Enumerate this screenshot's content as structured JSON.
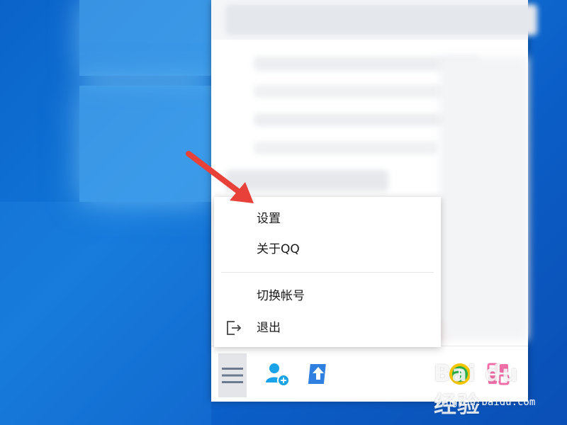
{
  "menu": {
    "settings": "设置",
    "about": "关于QQ",
    "switch_account": "切换帐号",
    "exit": "退出"
  },
  "toolbar": {
    "menu_icon": "hamburger-menu-icon",
    "add_contact_icon": "add-contact-icon",
    "upload_icon": "upload-arrow-icon",
    "music_icon": "qq-music-icon",
    "apps_icon": "app-manager-icon"
  },
  "colors": {
    "desktop_blue": "#0a63c9",
    "arrow_red": "#e8413a",
    "menu_bg": "#ffffff",
    "add_contact_blue": "#1aa3e8",
    "music_yellow": "#f6c500",
    "apps_pink": "#f06ea8"
  },
  "watermark": {
    "logo": "Bai du 经验",
    "url": "jingyan.baidu.com"
  }
}
